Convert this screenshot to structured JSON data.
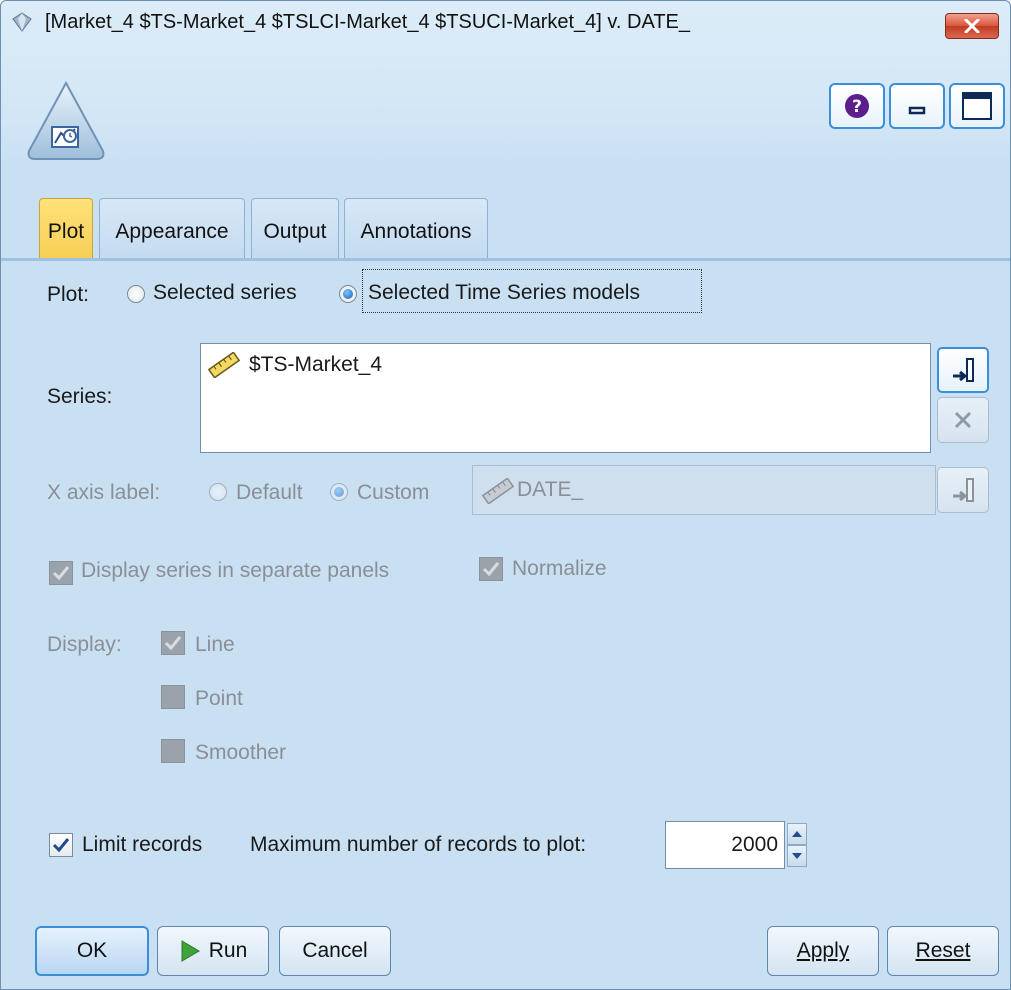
{
  "window": {
    "title": "[Market_4 $TS-Market_4 $TSLCI-Market_4 $TSUCI-Market_4] v. DATE_",
    "close_icon": "close-x-icon"
  },
  "toolbar": {
    "help_icon": "help-icon",
    "minimize_icon": "minimize-icon",
    "maximize_icon": "maximize-icon"
  },
  "tabs": [
    {
      "label": "Plot",
      "active": true
    },
    {
      "label": "Appearance",
      "active": false
    },
    {
      "label": "Output",
      "active": false
    },
    {
      "label": "Annotations",
      "active": false
    }
  ],
  "plot": {
    "label": "Plot:",
    "option_selected_series": "Selected series",
    "option_ts_models": "Selected Time Series models",
    "selected": "Selected Time Series models"
  },
  "series": {
    "label": "Series:",
    "items": [
      "$TS-Market_4"
    ]
  },
  "xaxis": {
    "label": "X axis label:",
    "option_default": "Default",
    "option_custom": "Custom",
    "selected": "Custom",
    "field_value": "DATE_"
  },
  "options": {
    "separate_panels": "Display series in separate panels",
    "separate_panels_checked": true,
    "normalize": "Normalize",
    "normalize_checked": true
  },
  "display": {
    "label": "Display:",
    "line": "Line",
    "line_checked": true,
    "point": "Point",
    "point_checked": false,
    "smoother": "Smoother",
    "smoother_checked": false
  },
  "limit": {
    "label": "Limit records",
    "checked": true,
    "max_label": "Maximum number of records to plot:",
    "max_value": "2000"
  },
  "buttons": {
    "ok": "OK",
    "run": "Run",
    "cancel": "Cancel",
    "apply": "Apply",
    "reset": "Reset"
  },
  "colors": {
    "window_bg": "#d2e6f6",
    "active_tab": "#f7cf55",
    "focus_border": "#3a8fd8"
  }
}
